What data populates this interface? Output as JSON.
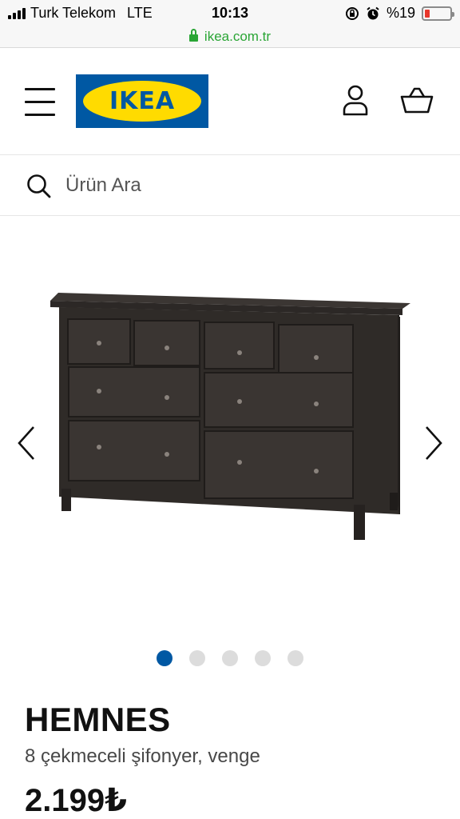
{
  "status_bar": {
    "carrier": "Turk Telekom",
    "network": "LTE",
    "time": "10:13",
    "battery_percent": "%19",
    "battery_level": 0.19,
    "icons": [
      "signal-icon",
      "orientation-lock-icon",
      "alarm-icon",
      "battery-icon"
    ]
  },
  "browser": {
    "url": "ikea.com.tr",
    "secure_color": "#2aa535"
  },
  "header": {
    "logo_text": "IKEA",
    "brand_blue": "#0058a3",
    "brand_yellow": "#ffdb00",
    "icons": [
      "hamburger-menu-icon",
      "user-icon",
      "shopping-basket-icon"
    ]
  },
  "search": {
    "placeholder": "Ürün Ara",
    "icon": "search-icon"
  },
  "gallery": {
    "slide_count": 5,
    "active_index": 0,
    "icons": [
      "chevron-left-icon",
      "chevron-right-icon"
    ]
  },
  "product": {
    "name": "HEMNES",
    "description": "8 çekmeceli şifonyer, venge",
    "price": "2.199₺"
  }
}
